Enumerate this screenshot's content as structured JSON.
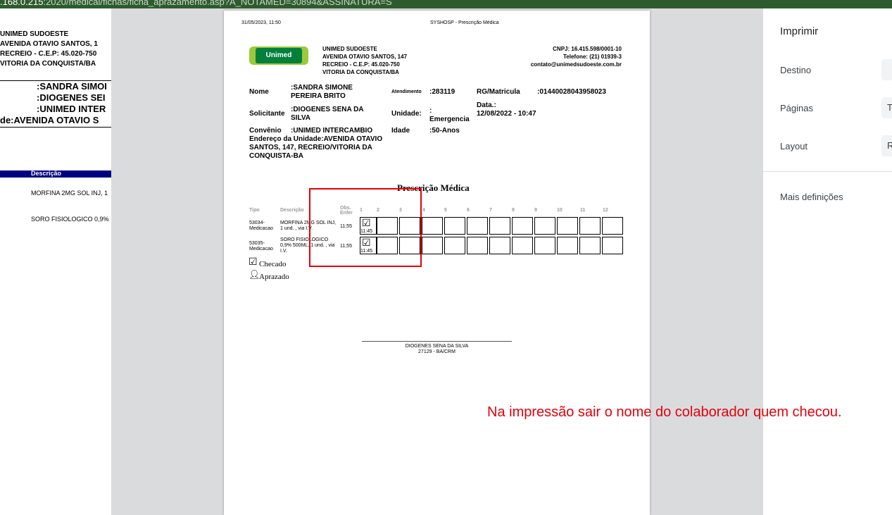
{
  "browser": {
    "url_prefix": ".168.0.215",
    "url_path": ":2020/medical/fichas/ficha_aprazamento.asp?A_NOTAMED=30894&ASSINATURA=S"
  },
  "background_page": {
    "address_lines": [
      "UNIMED SUDOESTE",
      "AVENIDA OTAVIO SANTOS, 1",
      "RECREIO - C.E.P: 45.020-750",
      "VITORIA DA CONQUISTA/BA"
    ],
    "patient_lines": [
      ":SANDRA SIMOI",
      ":DIOGENES SEI",
      ":UNIMED INTER",
      "de:AVENIDA OTAVIO S"
    ],
    "table_header": "Descrição",
    "rows": [
      "MORFINA 2MG SOL INJ, 1",
      "SORO FISIOLOGICO 0,9%"
    ]
  },
  "document": {
    "print_datetime": "31/05/2023, 11:50",
    "print_title": "SYSHOSP - Prescrição Médica",
    "logo_text": "Unimed",
    "org": {
      "lines": [
        "UNIMED SUDOESTE",
        "AVENIDA OTAVIO SANTOS, 147",
        "RECREIO - C.E.P: 45.020-750",
        "VITORIA DA CONQUISTA/BA"
      ],
      "cnpj": "CNPJ: 16.415.598/0001-10",
      "phone": "Telefone: (21) 01939-3",
      "email": "contato@unimedsudoeste.com.br"
    },
    "patient": {
      "nome_label": "Nome",
      "nome_value": ":SANDRA SIMONE PEREIRA BRITO",
      "atendimento_label": "Atendimento",
      "atendimento_value": ":283119",
      "rg_label": "RG/Matricula",
      "rg_value": ":01440028043958023",
      "solicitante_label": "Solicitante",
      "solicitante_value": ":DIOGENES SENA DA SILVA",
      "unidade_label": "Unidade:",
      "unidade_value": ": Emergencia",
      "data_label": "Data.:",
      "data_value": "12/08/2022 - 10:47",
      "convenio_label": "Convênio",
      "convenio_value": ":UNIMED INTERCAMBIO",
      "idade_label": "Idade",
      "idade_value": ":50-Anos",
      "endereco": "Endereço da Unidade:AVENIDA OTAVIO SANTOS, 147, RECREIO/VITORIA DA CONQUISTA-BA"
    },
    "section_title": "Prescrição Médica",
    "table": {
      "headers": [
        "Tipo",
        "Descrição",
        "Obs. Enfer",
        "1",
        "2",
        "3",
        "4",
        "5",
        "6",
        "7",
        "8",
        "9",
        "10",
        "11",
        "12"
      ],
      "rows": [
        {
          "tipo": "53034-Medicacao",
          "descricao": "MORFINA 2MG SOL INJ, 1 und. , via I.V.",
          "hora": "11;55",
          "checked_time": "11:45"
        },
        {
          "tipo": "53035-Medicacao",
          "descricao": "SORO FISIOLOGICO 0,9% 500ML, 1 und. , via I.V.",
          "hora": "11;55",
          "checked_time": "11:45"
        }
      ]
    },
    "legend": {
      "checked": "Checado",
      "scheduled": "Aprazado"
    },
    "signature": {
      "name": "DIOGENES SENA DA SILVA",
      "crm": "27129 - BA/CRM"
    }
  },
  "print_panel": {
    "title": "Imprimir",
    "destino_label": "Destino",
    "paginas_label": "Páginas",
    "paginas_value": "T",
    "layout_label": "Layout",
    "layout_value": "R",
    "more_settings": "Mais definições"
  },
  "annotation": "Na impressão sair o nome do colaborador quem checou.",
  "colors": {
    "annotation_red": "#e3000b",
    "url_bar": "#2e5b2e",
    "table_header_blue": "#000080"
  }
}
